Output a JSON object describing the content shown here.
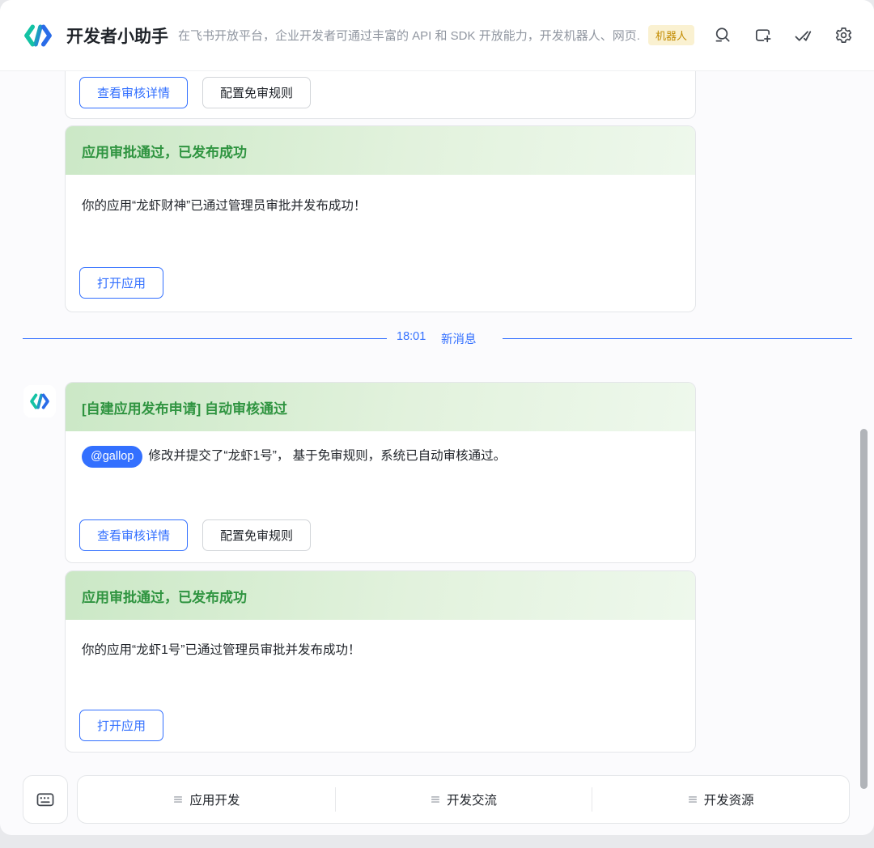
{
  "header": {
    "app_title": "开发者小助手",
    "app_description": "在飞书开放平台，企业开发者可通过丰富的 API 和 SDK 开放能力，开发机器人、网页...",
    "badge": "机器人",
    "icons": [
      "code-brackets-logo",
      "search-icon",
      "new-chat-icon",
      "double-check-icon",
      "gear-icon"
    ]
  },
  "chat": {
    "partial_card": {
      "view_details_label": "查看审核详情",
      "configure_rules_label": "配置免审规则"
    },
    "success_card_1": {
      "title": "应用审批通过，已发布成功",
      "body": "你的应用“龙虾财神”已通过管理员审批并发布成功！",
      "open_app_label": "打开应用"
    },
    "divider": {
      "time": "18:01",
      "label": "新消息"
    },
    "approval_card": {
      "title": "[自建应用发布申请] 自动审核通过",
      "mention": "@gallop",
      "body": "修改并提交了“龙虾1号”， 基于免审规则，系统已自动审核通过。",
      "view_details_label": "查看审核详情",
      "configure_rules_label": "配置免审规则"
    },
    "success_card_2": {
      "title": "应用审批通过，已发布成功",
      "body": "你的应用“龙虾1号”已通过管理员审批并发布成功！",
      "open_app_label": "打开应用"
    }
  },
  "bottom_bar": {
    "keyboard_icon": "keyboard-icon",
    "menu_items": [
      {
        "label": "应用开发"
      },
      {
        "label": "开发交流"
      },
      {
        "label": "开发资源"
      }
    ]
  },
  "colors": {
    "accent_blue": "#3370FF",
    "success_green": "#2F9440",
    "success_header_start": "#CBE8C6",
    "success_header_end": "#EEF8EC",
    "badge_bg": "#FAF1D1",
    "badge_text": "#C28B00",
    "logo_teal": "#14C3A4",
    "logo_blue": "#2A6CE8"
  }
}
